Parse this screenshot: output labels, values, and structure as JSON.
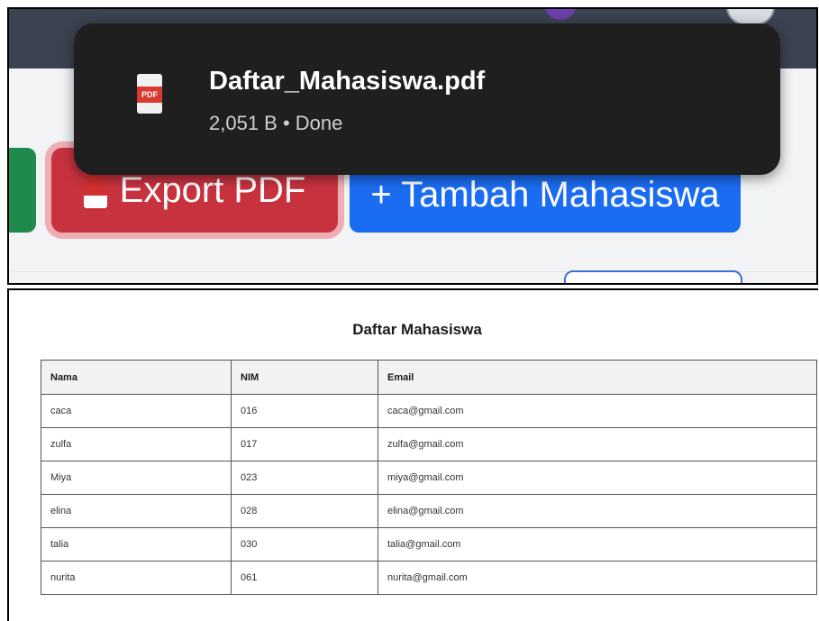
{
  "download": {
    "filename": "Daftar_Mahasiswa.pdf",
    "status": "2,051 B • Done",
    "icon": "pdf-file-icon",
    "icon_badge": "PDF"
  },
  "toolbar": {
    "export_label": "Export PDF",
    "add_label": "+ Tambah Mahasiswa"
  },
  "colors": {
    "export_button": "#c8323f",
    "add_button": "#1a6cf2",
    "green_button": "#1f8a4c",
    "toast_background": "#1f1f1f"
  },
  "pdf": {
    "title": "Daftar Mahasiswa",
    "columns": [
      "Nama",
      "NIM",
      "Email"
    ],
    "rows": [
      [
        "caca",
        "016",
        "caca@gmail.com"
      ],
      [
        "zulfa",
        "017",
        "zulfa@gmail.com"
      ],
      [
        "Miya",
        "023",
        "miya@gmail.com"
      ],
      [
        "elina",
        "028",
        "elina@gmail.com"
      ],
      [
        "talia",
        "030",
        "talia@gmail.com"
      ],
      [
        "nurita",
        "061",
        "nurita@gmail.com"
      ]
    ]
  }
}
